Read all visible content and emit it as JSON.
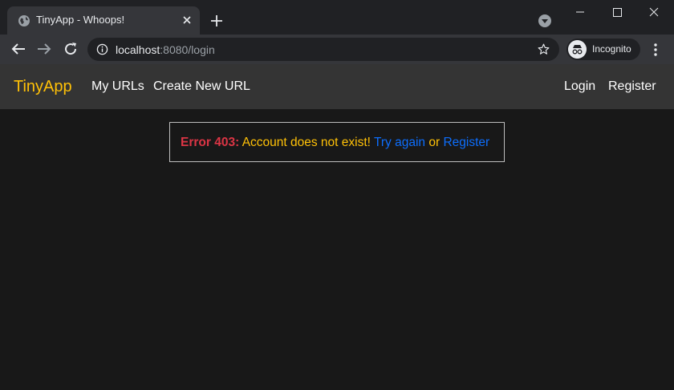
{
  "browser": {
    "tab_title": "TinyApp - Whoops!",
    "url_host": "localhost",
    "url_rest": ":8080/login",
    "profile_label": "Incognito"
  },
  "site": {
    "brand": "TinyApp",
    "nav_left": [
      "My URLs",
      "Create New URL"
    ],
    "nav_right": [
      "Login",
      "Register"
    ]
  },
  "error": {
    "code": "Error 403:",
    "message": "Account does not exist!",
    "retry_link": "Try again",
    "joiner": "or",
    "register_link": "Register"
  },
  "colors": {
    "brand": "#ffc107",
    "error_code": "#dc3545",
    "link": "#0d6efd",
    "page_bg": "#181818",
    "navbar_bg": "#343434"
  }
}
